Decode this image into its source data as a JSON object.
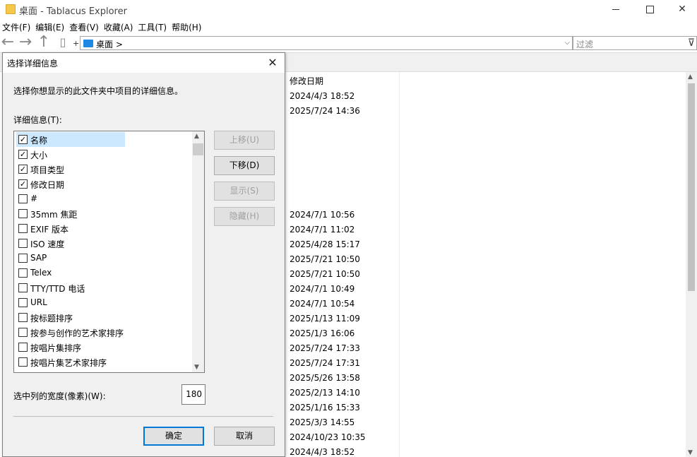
{
  "window": {
    "title": "桌面 - Tablacus Explorer"
  },
  "menu": [
    "文件(F)",
    "编辑(E)",
    "查看(V)",
    "收藏(A)",
    "工具(T)",
    "帮助(H)"
  ],
  "toolbar": {
    "plus": "+",
    "address": "桌面",
    "address_sep": ">",
    "filter_placeholder": "过滤"
  },
  "list": {
    "column_header": "修改日期",
    "dates": [
      "2024/4/3 18:52",
      "2025/7/24 14:36",
      "2024/7/1 10:56",
      "2024/7/1 11:02",
      "2025/4/28 15:17",
      "2025/7/21 10:50",
      "2025/7/21 10:50",
      "2024/7/1 10:49",
      "2024/7/1 10:54",
      "2025/1/13 11:09",
      "2025/1/3 16:06",
      "2025/7/24 17:33",
      "2025/7/24 17:31",
      "2025/5/26 13:58",
      "2025/2/13 14:10",
      "2025/1/16 15:33",
      "2025/3/3 14:55",
      "2024/10/23 10:35",
      "2024/4/3 18:52"
    ]
  },
  "dialog": {
    "title": "选择详细信息",
    "description": "选择你想显示的此文件夹中项目的详细信息。",
    "details_label": "详细信息(T):",
    "items": [
      {
        "label": "名称",
        "checked": true
      },
      {
        "label": "大小",
        "checked": true
      },
      {
        "label": "项目类型",
        "checked": true
      },
      {
        "label": "修改日期",
        "checked": true
      },
      {
        "label": "#",
        "checked": false
      },
      {
        "label": "35mm 焦距",
        "checked": false
      },
      {
        "label": "EXIF 版本",
        "checked": false
      },
      {
        "label": "ISO 速度",
        "checked": false
      },
      {
        "label": "SAP",
        "checked": false
      },
      {
        "label": "Telex",
        "checked": false
      },
      {
        "label": "TTY/TTD 电话",
        "checked": false
      },
      {
        "label": "URL",
        "checked": false
      },
      {
        "label": "按标题排序",
        "checked": false
      },
      {
        "label": "按参与创作的艺术家排序",
        "checked": false
      },
      {
        "label": "按唱片集排序",
        "checked": false
      },
      {
        "label": "按唱片集艺术家排序",
        "checked": false
      }
    ],
    "buttons": {
      "move_up": "上移(U)",
      "move_down": "下移(D)",
      "show": "显示(S)",
      "hide": "隐藏(H)",
      "ok": "确定",
      "cancel": "取消"
    },
    "width_label": "选中列的宽度(像素)(W):",
    "width_value": "180"
  }
}
